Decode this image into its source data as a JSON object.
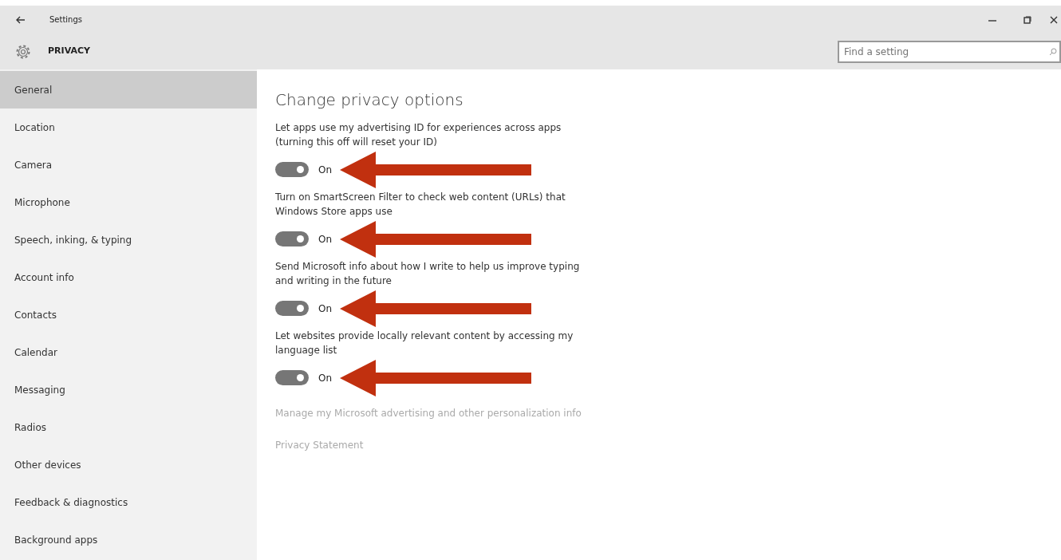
{
  "window": {
    "title": "Settings"
  },
  "header": {
    "title": "PRIVACY",
    "search": {
      "placeholder": "Find a setting"
    }
  },
  "sidebar": {
    "items": [
      {
        "label": "General",
        "selected": true
      },
      {
        "label": "Location",
        "selected": false
      },
      {
        "label": "Camera",
        "selected": false
      },
      {
        "label": "Microphone",
        "selected": false
      },
      {
        "label": "Speech, inking, & typing",
        "selected": false
      },
      {
        "label": "Account info",
        "selected": false
      },
      {
        "label": "Contacts",
        "selected": false
      },
      {
        "label": "Calendar",
        "selected": false
      },
      {
        "label": "Messaging",
        "selected": false
      },
      {
        "label": "Radios",
        "selected": false
      },
      {
        "label": "Other devices",
        "selected": false
      },
      {
        "label": "Feedback & diagnostics",
        "selected": false
      },
      {
        "label": "Background apps",
        "selected": false
      }
    ]
  },
  "content": {
    "heading": "Change privacy options",
    "settings": [
      {
        "description": "Let apps use my advertising ID for experiences across apps (turning this off will reset your ID)",
        "on": true,
        "state_label": "On",
        "arrow": true
      },
      {
        "description": "Turn on SmartScreen Filter to check web content (URLs) that Windows Store apps use",
        "on": true,
        "state_label": "On",
        "arrow": true
      },
      {
        "description": "Send Microsoft info about how I write to help us improve typing and writing in the future",
        "on": true,
        "state_label": "On",
        "arrow": true
      },
      {
        "description": "Let websites provide locally relevant content by accessing my language list",
        "on": true,
        "state_label": "On",
        "arrow": true
      }
    ],
    "links": [
      "Manage my Microsoft advertising and other personalization info",
      "Privacy Statement"
    ]
  }
}
